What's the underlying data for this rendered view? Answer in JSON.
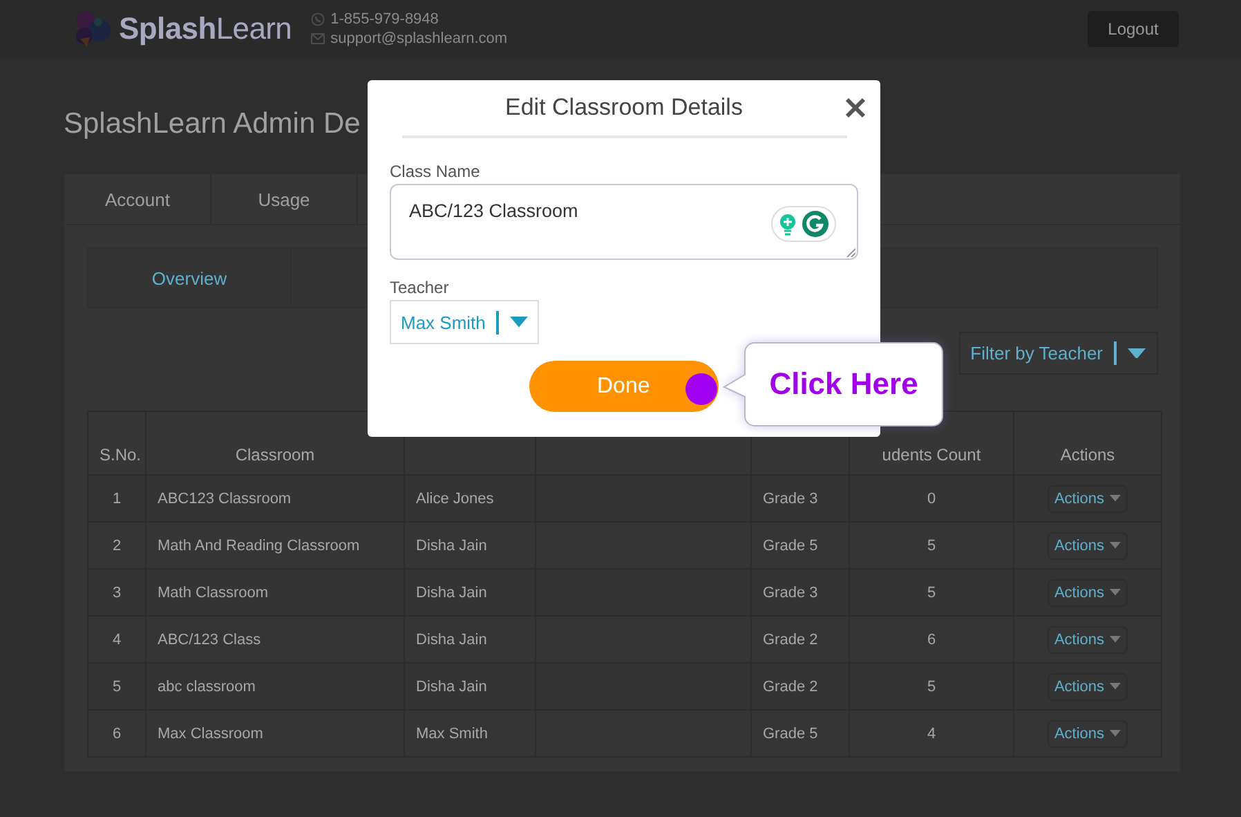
{
  "header": {
    "logo": "**Splash**Learn",
    "phone": "1-855-979-8948",
    "email": "support@splashlearn.com",
    "logout": "Logout"
  },
  "page_title": "SplashLearn Admin De",
  "tabs": [
    {
      "label": "Account",
      "selected": false
    },
    {
      "label": "Usage",
      "selected": false
    }
  ],
  "subtabs": [
    {
      "label": "Overview",
      "selected": true
    }
  ],
  "filter": {
    "label": "Filter by Teacher"
  },
  "table": {
    "columns": [
      "S.No.",
      "Classroom",
      null,
      null,
      null,
      "udents Count",
      "Actions"
    ],
    "rows": [
      [
        "1",
        "ABC123 Classroom",
        "Alice Jones",
        "",
        "Grade 3",
        "0",
        "Actions"
      ],
      [
        "2",
        "Math And Reading Classroom",
        "Disha Jain",
        "",
        "Grade 5",
        "5",
        "Actions"
      ],
      [
        "3",
        "Math Classroom",
        "Disha Jain",
        "",
        "Grade 3",
        "5",
        "Actions"
      ],
      [
        "4",
        "ABC/123 Class",
        "Disha Jain",
        "",
        "Grade 2",
        "6",
        "Actions"
      ],
      [
        "5",
        "abc classroom",
        "Disha Jain",
        "",
        "Grade 2",
        "5",
        "Actions"
      ],
      [
        "6",
        "Max Classroom",
        "Max Smith",
        "",
        "Grade 5",
        "4",
        "Actions"
      ]
    ]
  },
  "dialog": {
    "title": "Edit Classroom Details",
    "class_name_label": "Class Name",
    "class_name_value": "ABC/123 Classroom",
    "teacher_label": "Teacher",
    "teacher_value": "Max Smith",
    "done": "Done"
  },
  "callout": {
    "text": "Click Here"
  }
}
